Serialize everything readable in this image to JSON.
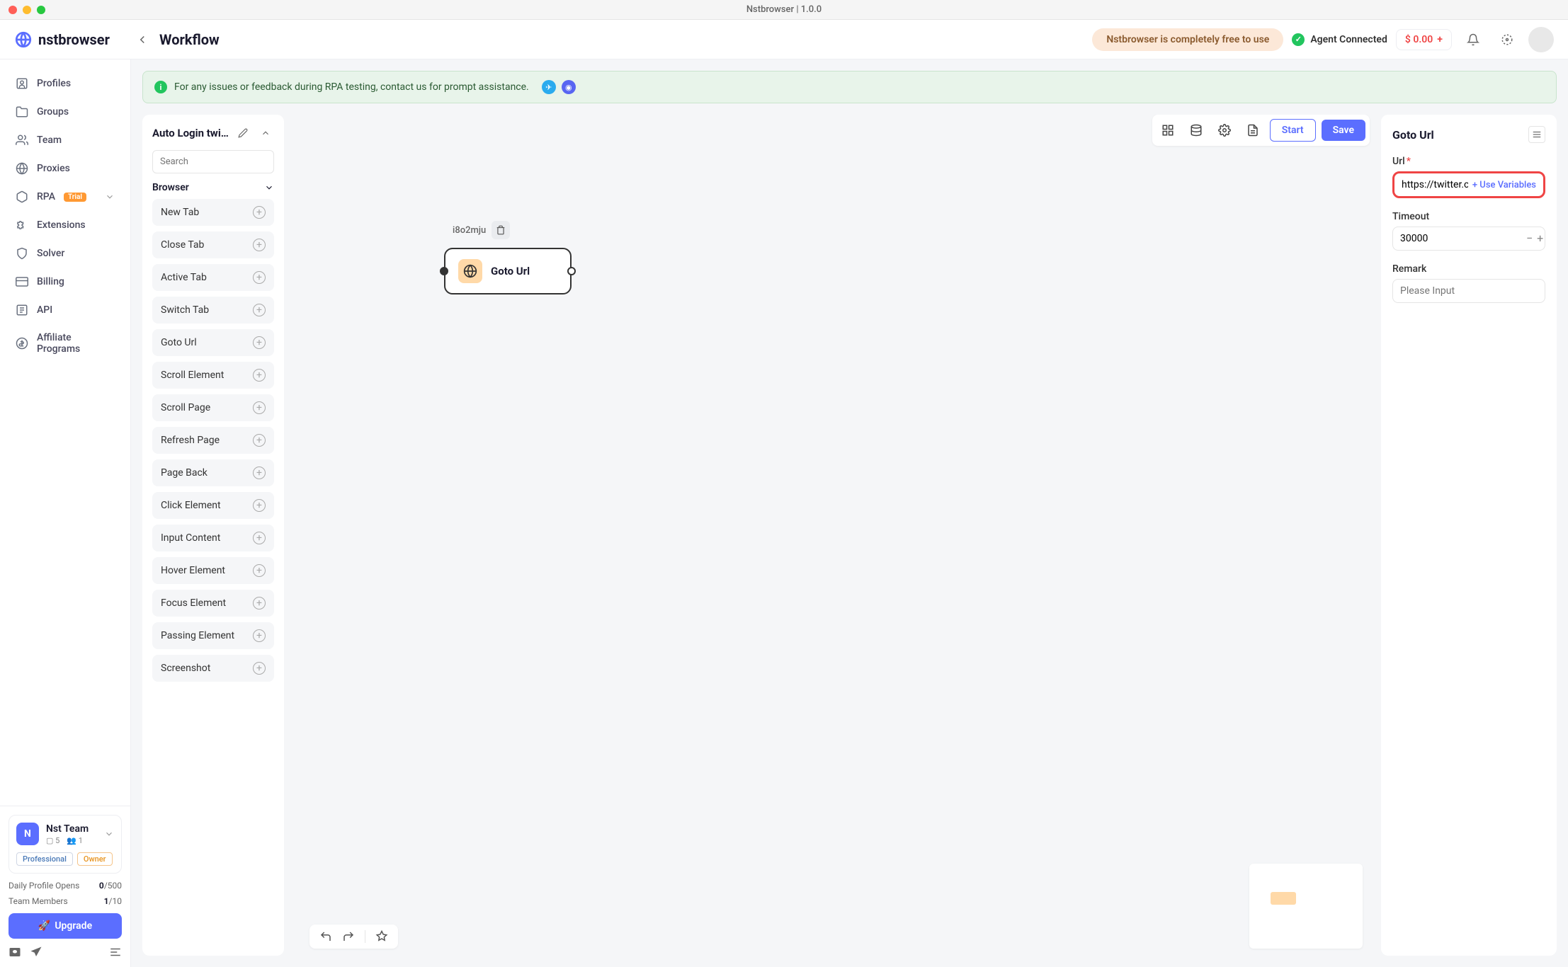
{
  "titlebar": {
    "title": "Nstbrowser | 1.0.0"
  },
  "header": {
    "logo": "nstbrowser",
    "page_title": "Workflow",
    "free_banner": "Nstbrowser is completely free to use",
    "agent_status": "Agent Connected",
    "balance": "$ 0.00"
  },
  "sidebar": {
    "items": [
      {
        "label": "Profiles",
        "icon": "profiles"
      },
      {
        "label": "Groups",
        "icon": "folder"
      },
      {
        "label": "Team",
        "icon": "users"
      },
      {
        "label": "Proxies",
        "icon": "globe"
      },
      {
        "label": "RPA",
        "icon": "cube",
        "badge": "Trial",
        "expandable": true
      },
      {
        "label": "Extensions",
        "icon": "puzzle"
      },
      {
        "label": "Solver",
        "icon": "shield"
      },
      {
        "label": "Billing",
        "icon": "card"
      },
      {
        "label": "API",
        "icon": "api"
      },
      {
        "label": "Affiliate Programs",
        "icon": "dollar"
      }
    ],
    "team": {
      "avatar_letter": "N",
      "name": "Nst Team",
      "profiles_count": "5",
      "members_count": "1",
      "tier": "Professional",
      "role": "Owner"
    },
    "stats": {
      "daily_label": "Daily Profile Opens",
      "daily_value": "0",
      "daily_max": "/500",
      "members_label": "Team Members",
      "members_value": "1",
      "members_max": "/10"
    },
    "upgrade": "Upgrade"
  },
  "notice": {
    "text": "For any issues or feedback during RPA testing, contact us for prompt assistance."
  },
  "actions_panel": {
    "title": "Auto Login twitt...",
    "search_placeholder": "Search",
    "category": "Browser",
    "items": [
      "New Tab",
      "Close Tab",
      "Active Tab",
      "Switch Tab",
      "Goto Url",
      "Scroll Element",
      "Scroll Page",
      "Refresh Page",
      "Page Back",
      "Click Element",
      "Input Content",
      "Hover Element",
      "Focus Element",
      "Passing Element",
      "Screenshot"
    ]
  },
  "toolbar": {
    "start": "Start",
    "save": "Save"
  },
  "node": {
    "id": "i8o2mju",
    "label": "Goto Url"
  },
  "props": {
    "title": "Goto Url",
    "url_label": "Url",
    "url_value": "https://twitter.com",
    "use_variables": "+ Use Variables",
    "timeout_label": "Timeout",
    "timeout_value": "30000",
    "remark_label": "Remark",
    "remark_placeholder": "Please Input"
  }
}
